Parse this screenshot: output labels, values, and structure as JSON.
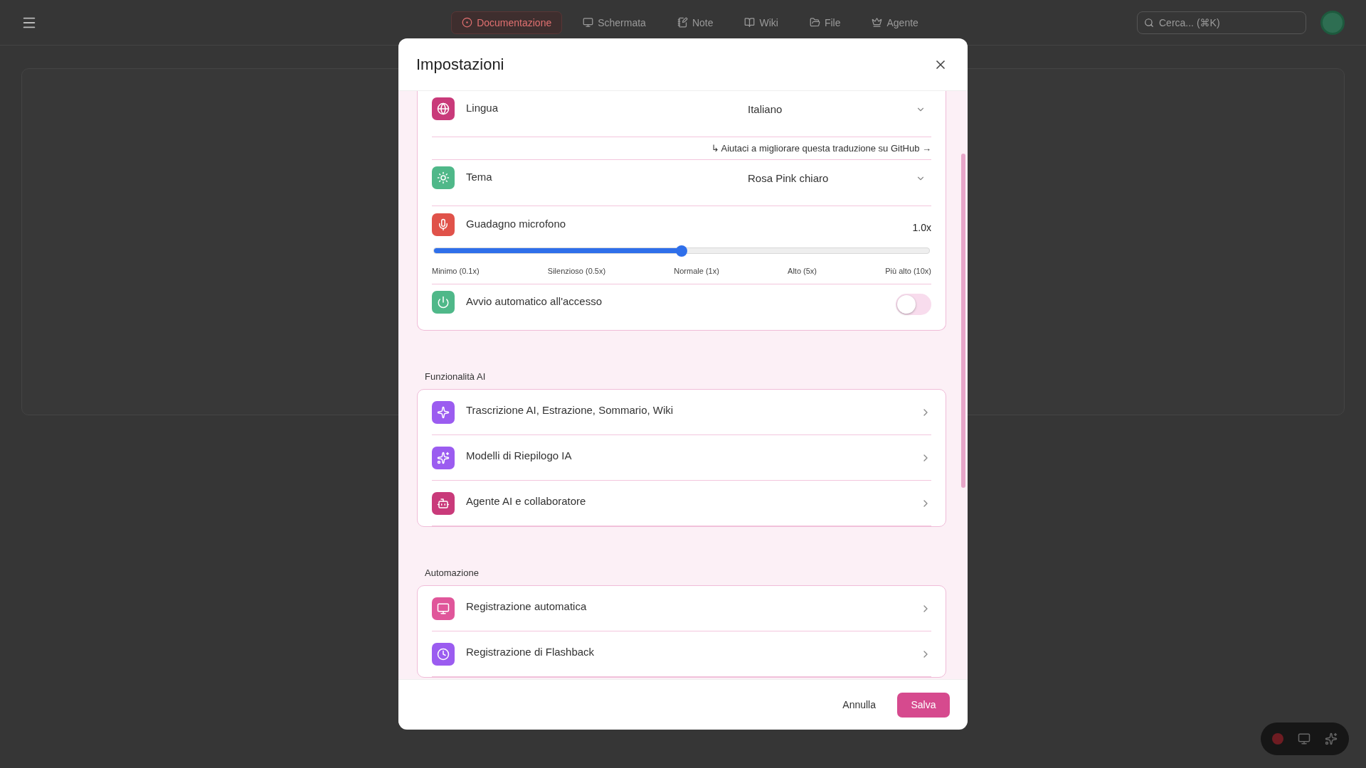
{
  "nav": {
    "tabs": [
      {
        "label": "Documentazione",
        "selected": true
      },
      {
        "label": "Schermata",
        "selected": false
      },
      {
        "label": "Note",
        "selected": false
      },
      {
        "label": "Wiki",
        "selected": false
      },
      {
        "label": "File",
        "selected": false
      },
      {
        "label": "Agente",
        "selected": false
      }
    ],
    "search": {
      "placeholder": "Cerca... (⌘K)"
    }
  },
  "dialog": {
    "title": "Impostazioni",
    "general": [
      {
        "kind": "select",
        "label": "Lingua",
        "color": "#c93a7a",
        "value": "Italiano"
      },
      {
        "kind": "link",
        "text": "↳ Aiutaci a migliorare questa traduzione su GitHub →"
      },
      {
        "kind": "select",
        "label": "Tema",
        "color": "#4fb889",
        "value": "Rosa Pink chiaro"
      },
      {
        "kind": "slider",
        "label": "Guadagno microfono",
        "color": "#e0524a",
        "reading": "1.0x",
        "level": 0.5,
        "ticks": [
          "Minimo (0.1x)",
          "Silenzioso (0.5x)",
          "Normale (1x)",
          "Alto (5x)",
          "Più alto (10x)"
        ]
      },
      {
        "kind": "toggle",
        "label": "Avvio automatico all'accesso",
        "color": "#4fb889",
        "on": false
      }
    ],
    "sections": [
      {
        "title": "Funzionalità AI",
        "items": [
          {
            "label": "Trascrizione AI, Estrazione, Sommario, Wiki",
            "color": "#9b5cf0"
          },
          {
            "label": "Modelli di Riepilogo IA",
            "color": "#9b5cf0"
          },
          {
            "label": "Agente AI e collaboratore",
            "color": "#c93a7a"
          }
        ]
      },
      {
        "title": "Automazione",
        "items": [
          {
            "label": "Registrazione automatica",
            "color": "#e0569a"
          },
          {
            "label": "Registrazione di Flashback",
            "color": "#9b5cf0"
          }
        ]
      }
    ],
    "buttons": {
      "cancel": "Annulla",
      "save": "Salva"
    }
  }
}
